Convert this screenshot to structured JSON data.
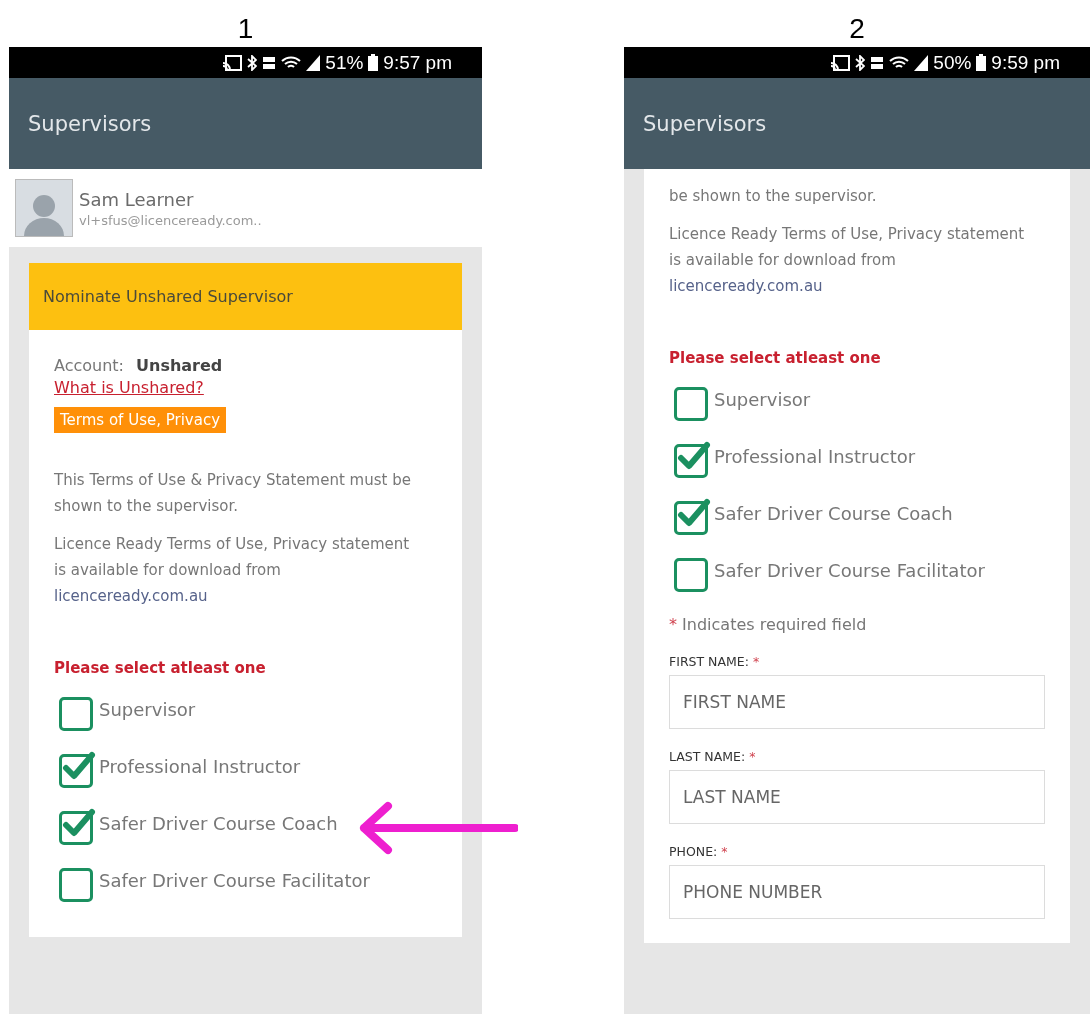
{
  "panels": [
    {
      "label": "1",
      "status_bar": {
        "battery": "51%",
        "time": "9:57 pm"
      },
      "app_bar": {
        "title": "Supervisors"
      },
      "profile": {
        "name": "Sam Learner",
        "email": "vl+sfus@licenceready.com.."
      },
      "card": {
        "header": "Nominate Unshared Supervisor",
        "items": [
          {
            "kind": "account",
            "label": "Account:",
            "value": "Unshared"
          },
          {
            "kind": "link",
            "text": "What is Unshared?"
          },
          {
            "kind": "terms_button",
            "text": "Terms of Use, Privacy"
          },
          {
            "kind": "paragraph",
            "text": "This Terms of Use & Privacy Statement must be shown to the supervisor."
          },
          {
            "kind": "paragraph",
            "text": "Licence Ready Terms of Use, Privacy statement is available for download from",
            "link": "licenceready.com.au"
          },
          {
            "kind": "warning",
            "text": "Please select atleast one"
          },
          {
            "kind": "checkbox",
            "text": "Supervisor",
            "checked": false
          },
          {
            "kind": "checkbox",
            "text": "Professional Instructor",
            "checked": true
          },
          {
            "kind": "checkbox",
            "text": "Safer Driver Course Coach",
            "checked": true
          },
          {
            "kind": "checkbox",
            "text": "Safer Driver Course Facilitator",
            "checked": false
          }
        ]
      }
    },
    {
      "label": "2",
      "status_bar": {
        "battery": "50%",
        "time": "9:59 pm"
      },
      "app_bar": {
        "title": "Supervisors"
      },
      "card": {
        "items": [
          {
            "kind": "paragraph",
            "text": "be shown to the supervisor."
          },
          {
            "kind": "paragraph",
            "text": "Licence Ready Terms of Use, Privacy statement is available for download from",
            "link": "licenceready.com.au"
          },
          {
            "kind": "warning",
            "text": "Please select atleast one"
          },
          {
            "kind": "checkbox",
            "text": "Supervisor",
            "checked": false
          },
          {
            "kind": "checkbox",
            "text": "Professional Instructor",
            "checked": true
          },
          {
            "kind": "checkbox",
            "text": "Safer Driver Course Coach",
            "checked": true
          },
          {
            "kind": "checkbox",
            "text": "Safer Driver Course Facilitator",
            "checked": false
          },
          {
            "kind": "required_note",
            "mark": "*",
            "text": "Indicates required field"
          },
          {
            "kind": "field",
            "label": "FIRST NAME:",
            "mark": "*",
            "placeholder": "FIRST NAME"
          },
          {
            "kind": "field",
            "label": "LAST NAME:",
            "mark": "*",
            "placeholder": "LAST NAME"
          },
          {
            "kind": "field",
            "label": "PHONE:",
            "mark": "*",
            "placeholder": "PHONE NUMBER"
          }
        ]
      }
    }
  ]
}
